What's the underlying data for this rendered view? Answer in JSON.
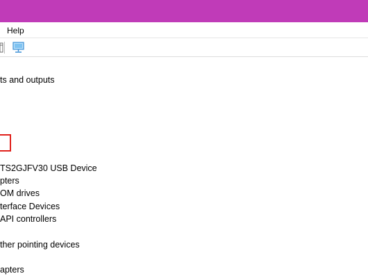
{
  "menu": {
    "help_label": "Help"
  },
  "toolbar": {
    "icons": [
      "properties-icon",
      "scan-hardware-icon"
    ]
  },
  "tree": {
    "items": [
      {
        "label": "ts and outputs"
      },
      {
        "label": "TS2GJFV30 USB Device"
      },
      {
        "label": "pters"
      },
      {
        "label": "OM drives"
      },
      {
        "label": "terface Devices"
      },
      {
        "label": "API controllers"
      },
      {
        "label": "ther pointing devices"
      },
      {
        "label": "apters"
      }
    ]
  },
  "colors": {
    "titlebar": "#c03bb8",
    "highlight_box": "#e0201b",
    "monitor_icon": "#3a8fd6"
  }
}
